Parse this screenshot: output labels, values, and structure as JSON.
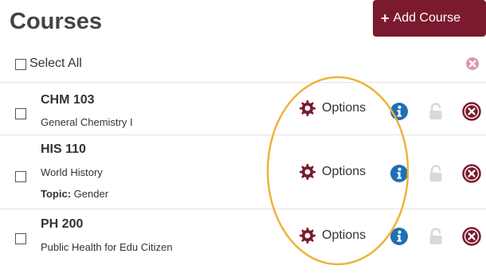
{
  "header": {
    "title": "Courses",
    "add_course_label": "Add Course",
    "add_course_icon": "plus-icon"
  },
  "select_all": {
    "label": "Select All",
    "checked": false
  },
  "courses": [
    {
      "code": "CHM 103",
      "name": "General Chemistry I",
      "topic_key": "",
      "topic_value": "",
      "options_label": "Options"
    },
    {
      "code": "HIS 110",
      "name": "World History",
      "topic_key": "Topic:",
      "topic_value": "Gender",
      "options_label": "Options"
    },
    {
      "code": "PH 200",
      "name": "Public Health for Edu Citizen",
      "topic_key": "",
      "topic_value": "",
      "options_label": "Options"
    }
  ],
  "icons": {
    "options": "gear-icon",
    "info": "info-icon",
    "lock": "lock-icon",
    "remove": "remove-circle-icon"
  },
  "colors": {
    "brand": "#7b1a2e",
    "info": "#1e6fb5",
    "lock": "#d9d9d9",
    "highlight": "#efb23a",
    "remove_all_muted": "#d99aa6"
  }
}
